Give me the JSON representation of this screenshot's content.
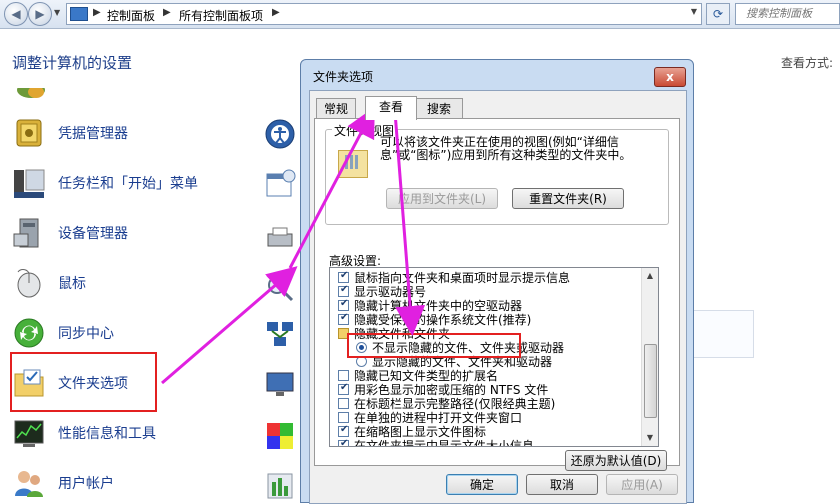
{
  "address_bar": {
    "back": "◀",
    "forward": "▶",
    "breadcrumbs": [
      "控制面板",
      "所有控制面板项"
    ],
    "search_placeholder": "搜索控制面板"
  },
  "main": {
    "heading": "调整计算机的设置",
    "view_by": "查看方式:",
    "items": [
      {
        "label": "凭据管理器",
        "icon": "vault-icon"
      },
      {
        "label": "任务栏和「开始」菜单",
        "icon": "taskbar-icon"
      },
      {
        "label": "设备管理器",
        "icon": "device-manager-icon"
      },
      {
        "label": "鼠标",
        "icon": "mouse-icon"
      },
      {
        "label": "同步中心",
        "icon": "sync-center-icon"
      },
      {
        "label": "文件夹选项",
        "icon": "folder-options-icon"
      },
      {
        "label": "性能信息和工具",
        "icon": "performance-icon"
      },
      {
        "label": "用户帐户",
        "icon": "user-accounts-icon"
      }
    ]
  },
  "dialog": {
    "title": "文件夹选项",
    "close": "x",
    "tabs": [
      "常规",
      "查看",
      "搜索"
    ],
    "active_tab": "查看",
    "folder_view": {
      "group_title": "文件夹视图",
      "description": "可以将该文件夹正在使用的视图(例如“详细信息”或“图标”)应用到所有这种类型的文件夹中。",
      "apply_button": "应用到文件夹(L)",
      "reset_button": "重置文件夹(R)"
    },
    "advanced": {
      "label": "高级设置:",
      "rows": [
        {
          "text": "鼠标指向文件夹和桌面项时显示提示信息",
          "kind": "check",
          "checked": true,
          "indent": 1
        },
        {
          "text": "显示驱动器号",
          "kind": "check",
          "checked": true,
          "indent": 1
        },
        {
          "text": "隐藏计算机文件夹中的空驱动器",
          "kind": "check",
          "checked": true,
          "indent": 1
        },
        {
          "text": "隐藏受保护的操作系统文件(推荐)",
          "kind": "check",
          "checked": true,
          "indent": 1
        },
        {
          "text": "隐藏文件和文件夹",
          "kind": "folder",
          "checked": false,
          "indent": 1
        },
        {
          "text": "不显示隐藏的文件、文件夹或驱动器",
          "kind": "radio",
          "checked": true,
          "indent": 2
        },
        {
          "text": "显示隐藏的文件、文件夹和驱动器",
          "kind": "radio",
          "checked": false,
          "indent": 2
        },
        {
          "text": "隐藏已知文件类型的扩展名",
          "kind": "check",
          "checked": false,
          "indent": 1
        },
        {
          "text": "用彩色显示加密或压缩的 NTFS 文件",
          "kind": "check",
          "checked": true,
          "indent": 1
        },
        {
          "text": "在标题栏显示完整路径(仅限经典主题)",
          "kind": "check",
          "checked": false,
          "indent": 1
        },
        {
          "text": "在单独的进程中打开文件夹窗口",
          "kind": "check",
          "checked": false,
          "indent": 1
        },
        {
          "text": "在缩略图上显示文件图标",
          "kind": "check",
          "checked": true,
          "indent": 1
        },
        {
          "text": "在文件夹提示中显示文件大小信息",
          "kind": "check",
          "checked": true,
          "indent": 1
        }
      ],
      "restore_button": "还原为默认值(D)"
    },
    "ok_button": "确定",
    "cancel_button": "取消",
    "apply_button": "应用(A)"
  },
  "colors": {
    "highlight": "#e32020",
    "arrow": "#e020e0",
    "link_text": "#1a3d8f"
  }
}
